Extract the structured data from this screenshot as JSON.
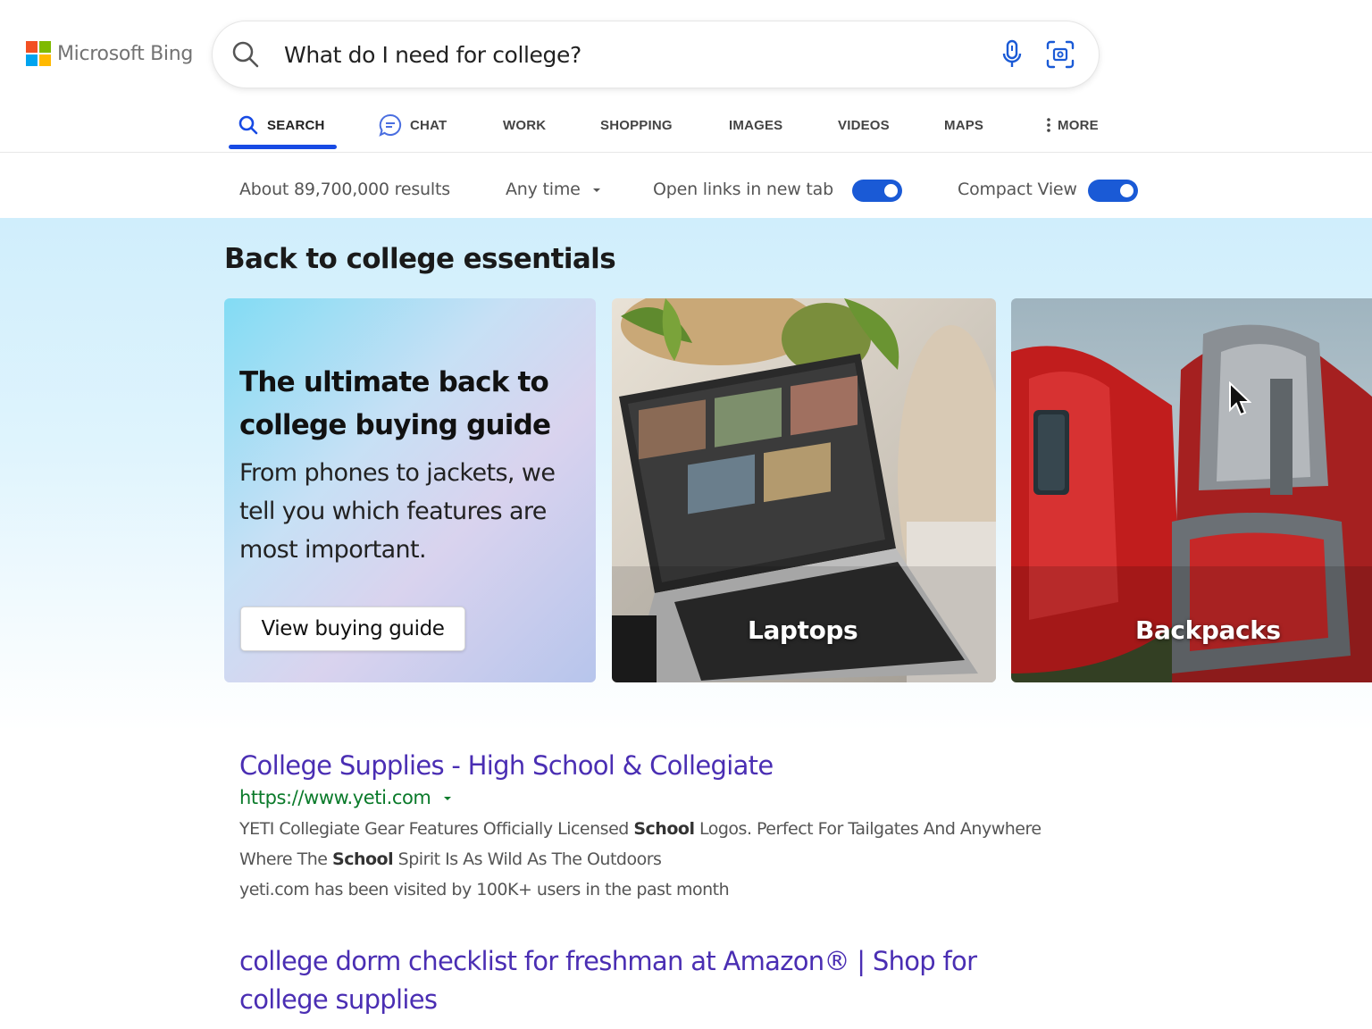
{
  "header": {
    "logo_text": "Microsoft Bing",
    "logo_colors": [
      "#f25022",
      "#7fba00",
      "#00a4ef",
      "#ffb900"
    ],
    "search_query": "What do I need for college?",
    "icons": {
      "search": "search-icon",
      "mic": "microphone-icon",
      "visual": "visual-search-icon"
    }
  },
  "tabs": [
    {
      "label": "SEARCH",
      "icon": "search-icon",
      "active": true
    },
    {
      "label": "CHAT",
      "icon": "chat-icon"
    },
    {
      "label": "WORK"
    },
    {
      "label": "SHOPPING"
    },
    {
      "label": "IMAGES"
    },
    {
      "label": "VIDEOS"
    },
    {
      "label": "MAPS"
    },
    {
      "label": "MORE",
      "icon": "more-vertical-icon"
    }
  ],
  "filters": {
    "result_count": "About 89,700,000 results",
    "time_filter": "Any time",
    "open_links_label": "Open links in new tab",
    "open_links_on": true,
    "compact_view_label": "Compact View",
    "compact_view_on": true
  },
  "hero": {
    "title": "Back to college essentials",
    "guide": {
      "title": "The ultimate back to college buying guide",
      "description": "From phones to jackets, we tell you which features are most important.",
      "button": "View buying guide"
    },
    "cards": [
      {
        "label": "Laptops"
      },
      {
        "label": "Backpacks"
      }
    ]
  },
  "results": [
    {
      "title": "College Supplies - High School & Collegiate",
      "url": "https://www.yeti.com",
      "snippet_parts": [
        "YETI Collegiate Gear Features Officially Licensed ",
        "School",
        " Logos. Perfect For Tailgates And Anywhere Where The ",
        "School",
        " Spirit Is As Wild As The Outdoors"
      ],
      "visits": "yeti.com has been visited by 100K+ users in the past month"
    },
    {
      "title": "college dorm checklist for freshman at Amazon® | Shop for college supplies"
    }
  ],
  "accent_color": "#174ae4",
  "link_color": "#4a2eb3",
  "url_color": "#0a7a2a"
}
